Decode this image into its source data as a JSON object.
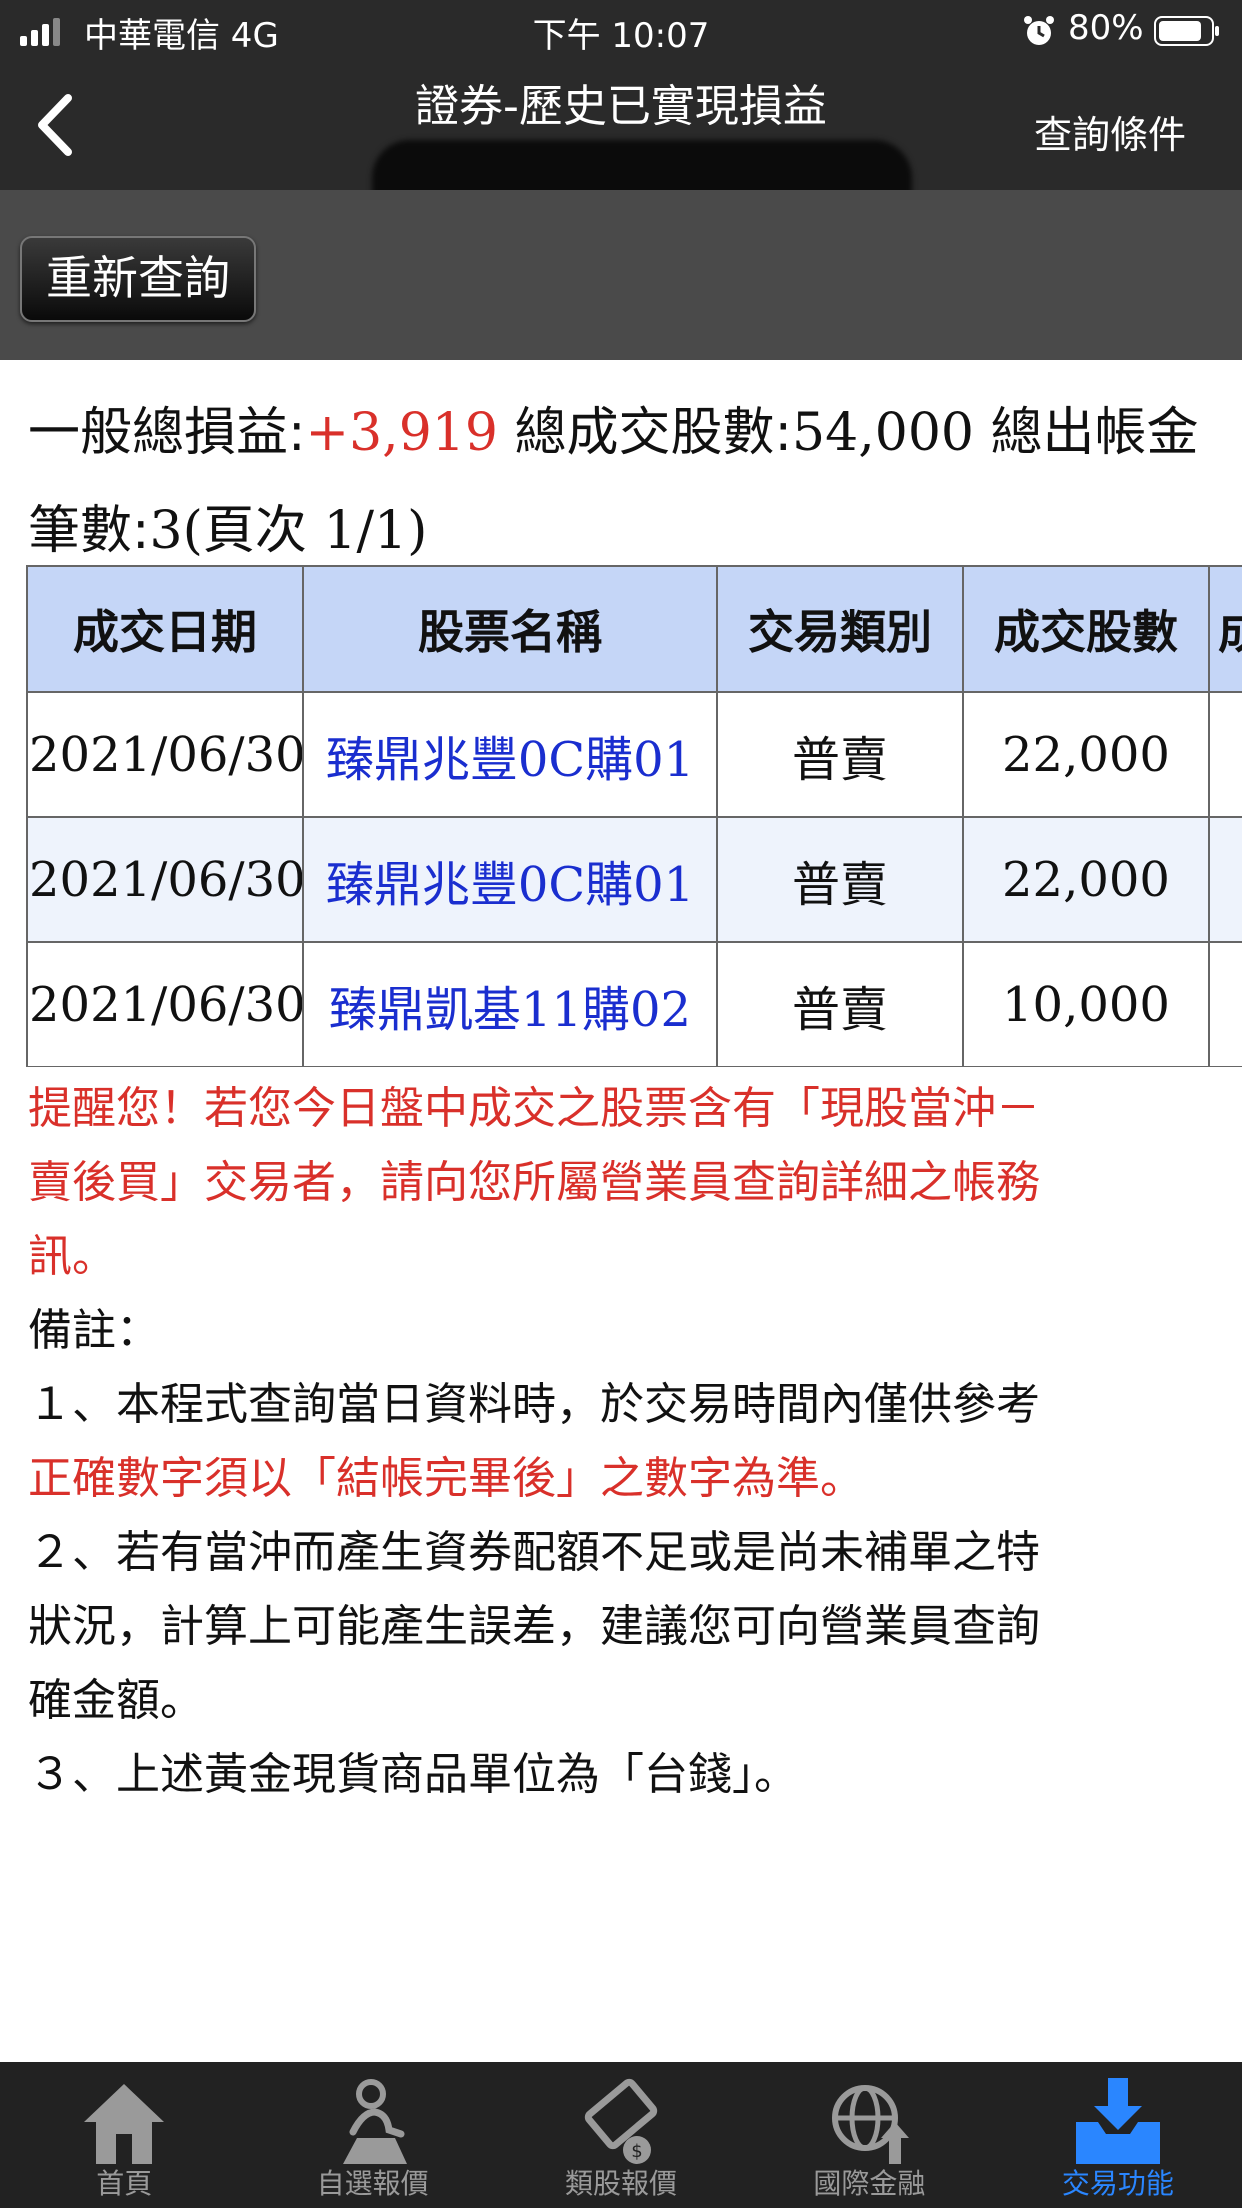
{
  "status_bar": {
    "carrier": "中華電信  4G",
    "time": "下午 10:07",
    "battery": "80%"
  },
  "nav": {
    "title": "證券-歷史已實現損益",
    "right_button": "查詢條件"
  },
  "toolbar": {
    "requery_label": "重新查詢"
  },
  "summary": {
    "pl_label": "一般總損益:",
    "pl_value": "+3,919",
    "shares_label": "總成交股數:",
    "shares_value": "54,000",
    "amount_label": "總出帳金",
    "count_label": "筆數:",
    "count_value": "3(",
    "page_label": "頁次",
    "page_value": " 1/1)"
  },
  "table": {
    "headers": [
      "成交日期",
      "股票名稱",
      "交易類別",
      "成交股數",
      "成"
    ],
    "rows": [
      {
        "date": "2021/06/30",
        "stock": "臻鼎兆豐0C購01",
        "type": "普賣",
        "shares": "22,000"
      },
      {
        "date": "2021/06/30",
        "stock": "臻鼎兆豐0C購01",
        "type": "普賣",
        "shares": "22,000"
      },
      {
        "date": "2021/06/30",
        "stock": "臻鼎凱基11購02",
        "type": "普賣",
        "shares": "10,000"
      }
    ]
  },
  "notes": {
    "reminder_1": "提醒您！若您今日盤中成交之股票含有「現股當沖－",
    "reminder_2": "賣後買」交易者，請向您所屬營業員查詢詳細之帳務",
    "reminder_3": "訊。",
    "remark_label": "備註：",
    "item1_a": "１、本程式查詢當日資料時，於交易時間內僅供參考",
    "item1_b": "正確數字須以「結帳完畢後」之數字為準。",
    "item2_a": "２、若有當沖而產生資券配額不足或是尚未補單之特",
    "item2_b": "狀況，計算上可能產生誤差，建議您可向營業員查詢",
    "item2_c": "確金額。",
    "item3": "３、上述黃金現貨商品單位為「台錢」。"
  },
  "tabs": [
    {
      "label": "首頁",
      "icon": "home-icon"
    },
    {
      "label": "自選報價",
      "icon": "person-icon"
    },
    {
      "label": "類股報價",
      "icon": "film-coin-icon"
    },
    {
      "label": "國際金融",
      "icon": "globe-icon"
    },
    {
      "label": "交易功能",
      "icon": "download-tray-icon",
      "active": true
    }
  ],
  "colors": {
    "accent_blue": "#2a86ff",
    "profit_red": "#d9302a",
    "header_blue": "#c5d6f7",
    "link_blue": "#1a2ecf"
  }
}
